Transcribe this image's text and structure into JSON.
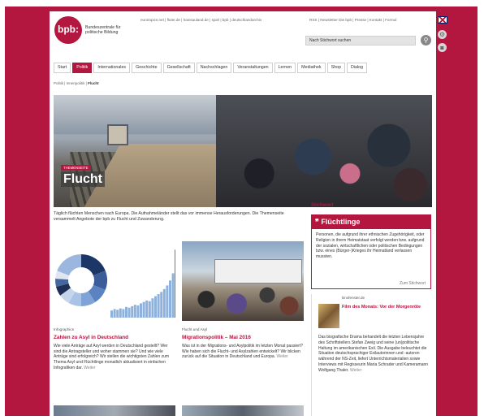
{
  "header": {
    "logo": "bpb:",
    "logo_text": "Bundeszentrale für politische Bildung",
    "toplinks_left": "eurotopics.net | fluter.de | hanisauland.de | spiel | bpb | deutschlandarchiv",
    "toplinks_right": "RSS | Newsletter     Die bpb | Presse | Kontakt | Formul",
    "search_placeholder": "Nach Stichwort suchen"
  },
  "nav": {
    "items": [
      "Start",
      "Politik",
      "Internationales",
      "Geschichte",
      "Gesellschaft",
      "Nachschlagen",
      "Veranstaltungen",
      "Lernen",
      "Mediathek",
      "Shop",
      "Dialog"
    ],
    "active": "Politik"
  },
  "breadcrumb": {
    "path": "Politik | Innenpolitik |",
    "current": "Flucht"
  },
  "hero": {
    "kicker": "THEMENSEITE",
    "title": "Flucht"
  },
  "intro": "Täglich flüchten Menschen nach Europa. Die Aufnahmeländer stellt das vor immense Herausforderungen. Die Themenseite versammelt Angebote der bpb zu Flucht und Zuwanderung.",
  "cards": [
    {
      "kicker": "Infographics",
      "title": "Zahlen zu Asyl in Deutschland",
      "text": "Wie viele Anträge auf Asyl werden in Deutschland gestellt? Wer sind die Antragsteller und woher stammen sie? Und wie viele Anträge sind erfolgreich? Wir stellen die wichtigsten Zahlen zum Thema Asyl und Flüchtlinge monatlich aktualisiert in einfachen Infografiken dar.",
      "more": "Weiter"
    },
    {
      "kicker": "Flucht und Asyl",
      "title": "Migrationspolitik – Mai 2016",
      "text": "Was ist in der Migrations- und Asylpolitik im letzten Monat passiert? Wie haben sich die Flucht- und Asylzahlen entwickelt? Wir blicken zurück auf die Situation in Deutschland und Europa.",
      "more": "Weiter"
    }
  ],
  "sidebar": {
    "stichwort": "Stichwort",
    "box_title": "Flüchtlinge",
    "box_icon": "quote-icon",
    "box_text": "Personen, die aufgrund ihrer ethnischen Zugehörigkeit, oder Religion in ihrem Heimatstaat verfolgt werden bzw. aufgrund der sozialen, wirtschaftlichen oder politischen Bedingungen bzw. eines (Bürger-)Krieges ihr Heimatland verlassen mussten.",
    "box_link": "Zum Stichwort",
    "film_kicker": "kinofenster.de",
    "film_title": "Film des Monats: Vor der Morgenröte",
    "film_text": "Das biografische Drama behandelt die letzten Lebensjahre des Schriftstellers Stefan Zweig und seine (un)politische Haltung im amerikanischen Exil. Die Ausgabe beleuchtet die Situation deutschsprachiger Exilautorinnen und -autoren während der NS-Zeit, liefert Unterrichtsmaterialien sowie Interviews mit Regisseurin Maria Schrader und Kameramann Wolfgang Thaler.",
    "film_more": "Weiter"
  },
  "colors": {
    "brand": "#b3163f",
    "nav_active_bg": "#b3163f"
  },
  "infographic": {
    "donut_segments": [
      0.19,
      0.12,
      0.1,
      0.09,
      0.08,
      0.07,
      0.06,
      0.05,
      0.05,
      0.19
    ],
    "bars": [
      0.1,
      0.12,
      0.11,
      0.13,
      0.12,
      0.15,
      0.14,
      0.16,
      0.18,
      0.17,
      0.2,
      0.22,
      0.24,
      0.23,
      0.27,
      0.3,
      0.33,
      0.36,
      0.4,
      0.45,
      0.52,
      0.62,
      0.95
    ]
  }
}
